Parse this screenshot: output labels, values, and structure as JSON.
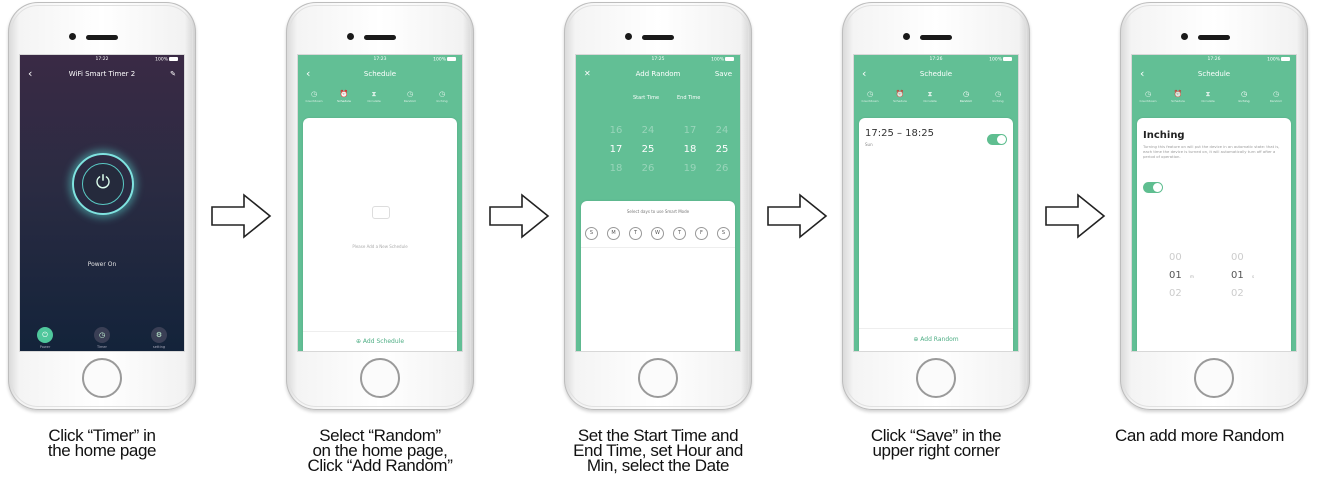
{
  "phone1": {
    "status_time": "17:22",
    "status_battery": "100%",
    "title": "WiFi Smart Timer 2",
    "back_icon": "‹",
    "edit_icon": "✎",
    "power_icon": "⏻",
    "power_status": "Power On",
    "tabs": [
      {
        "label": "Power",
        "icon": "⏻"
      },
      {
        "label": "Timer",
        "icon": "◷"
      },
      {
        "label": "setting",
        "icon": "⚙"
      }
    ]
  },
  "phone2": {
    "status_time": "17:23",
    "status_battery": "100%",
    "title": "Schedule",
    "back_icon": "‹",
    "icons": [
      {
        "sym": "◷",
        "label": "Countdown"
      },
      {
        "sym": "⏰",
        "label": "Schedule"
      },
      {
        "sym": "⧗",
        "label": "Circulate"
      },
      {
        "sym": "◷",
        "label": "Random"
      },
      {
        "sym": "◷",
        "label": "Inching"
      }
    ],
    "empty_text": "Please Add a New Schedule",
    "add_label": "Add Schedule",
    "add_icon": "⊕"
  },
  "phone3": {
    "status_time": "17:25",
    "status_battery": "100%",
    "close_icon": "✕",
    "title": "Add Random",
    "save": "Save",
    "start_label": "Start Time",
    "end_label": "End Time",
    "start_hours": [
      "16",
      "17",
      "18"
    ],
    "start_mins": [
      "24",
      "25",
      "26"
    ],
    "end_hours": [
      "17",
      "18",
      "19"
    ],
    "end_mins": [
      "24",
      "25",
      "26"
    ],
    "days_prompt": "Select days to use Smart Mode",
    "days": [
      "S",
      "M",
      "T",
      "W",
      "T",
      "F",
      "S"
    ]
  },
  "phone4": {
    "status_time": "17:26",
    "status_battery": "100%",
    "title": "Schedule",
    "back_icon": "‹",
    "icons": [
      {
        "sym": "◷",
        "label": "Countdown"
      },
      {
        "sym": "⏰",
        "label": "Schedule"
      },
      {
        "sym": "⧗",
        "label": "Circulate"
      },
      {
        "sym": "◷",
        "label": "Random"
      },
      {
        "sym": "◷",
        "label": "Inching"
      }
    ],
    "range": "17:25 – 18:25",
    "day": "Sun",
    "add_label": "Add Random",
    "add_icon": "⊕"
  },
  "phone5": {
    "status_time": "17:26",
    "status_battery": "100%",
    "title": "Schedule",
    "back_icon": "‹",
    "icons": [
      {
        "sym": "◷",
        "label": "Countdown"
      },
      {
        "sym": "⏰",
        "label": "Schedule"
      },
      {
        "sym": "⧗",
        "label": "Circulate"
      },
      {
        "sym": "◷",
        "label": "Inching"
      },
      {
        "sym": "◷",
        "label": "Random"
      }
    ],
    "inch_title": "Inching",
    "inch_desc": "Turning this feature on will put the device in an automatic state: that is, each time the device is turned on, it will automatically turn off after a period of operation.",
    "min_values": [
      "00",
      "01",
      "02"
    ],
    "sec_values": [
      "00",
      "01",
      "02"
    ],
    "min_unit": "m",
    "sec_unit": "s"
  },
  "captions": {
    "c1": [
      "Click “Timer” in",
      "the home page"
    ],
    "c2": [
      "Select “Random”",
      "on the home page,",
      "Click “Add Random”"
    ],
    "c3": [
      "Set the Start Time and",
      "End Time, set Hour and",
      "Min, select the Date"
    ],
    "c4": [
      "Click “Save” in the",
      "upper right corner"
    ],
    "c5": [
      "Can add more Random"
    ]
  },
  "colors": {
    "accent_green": "#62bf95",
    "dark_screen": "#2a2b42",
    "glow": "#7fe3e0"
  }
}
